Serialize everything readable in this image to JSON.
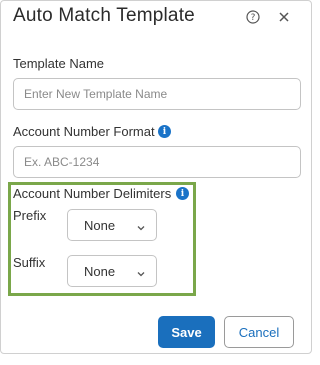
{
  "dialog": {
    "title": "Auto Match Template",
    "help_icon": "help-circle-icon",
    "close_icon": "close-icon"
  },
  "template_name": {
    "label": "Template Name",
    "value": "",
    "placeholder": "Enter New Template Name"
  },
  "account_number_format": {
    "label": "Account Number Format",
    "info_icon": "info-icon",
    "value": "",
    "placeholder": "Ex. ABC-1234"
  },
  "account_number_delimiters": {
    "label": "Account Number Delimiters",
    "info_icon": "info-icon",
    "highlight_color": "#7aa74a",
    "prefix": {
      "label": "Prefix",
      "value": "None"
    },
    "suffix": {
      "label": "Suffix",
      "value": "None"
    }
  },
  "footer": {
    "save_label": "Save",
    "cancel_label": "Cancel"
  },
  "colors": {
    "primary": "#1a6fbd",
    "info": "#1a73c8",
    "highlight": "#7aa74a"
  }
}
